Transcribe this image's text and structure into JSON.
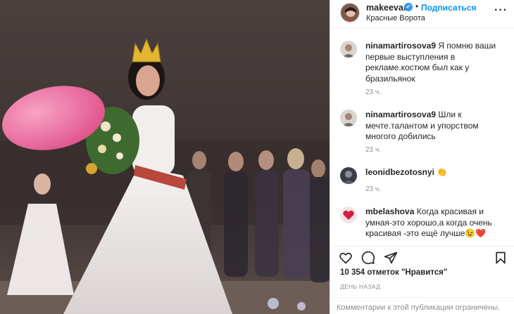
{
  "post": {
    "author": {
      "username": "makeevan",
      "verified_icon": "verified-badge-icon",
      "separator": "•",
      "follow_label": "Подписаться",
      "location": "Красные Ворота",
      "more_icon": "more-options-icon"
    },
    "comments": [
      {
        "username": "ninamartirosova9",
        "text": "Я помню ваши первые выступления в рекламе.костюм был как у бразильянок",
        "time": "23 ч."
      },
      {
        "username": "ninamartirosova9",
        "text": "Шли к мечте.талантом и упорством многого добились",
        "time": "23 ч."
      },
      {
        "username": "leonidbezotosnyi",
        "text": "👏",
        "time": "23 ч."
      },
      {
        "username": "mbelashova",
        "text": "Когда красивая и умная-это хорошо,а когда очень красивая -это ещё лучше😉❤️",
        "time": ""
      }
    ],
    "likes": "10 354 отметок \"Нравится\"",
    "date": "ДЕНЬ НАЗАД",
    "comments_limited": "Комментарии к этой публикации ограничены."
  },
  "colors": {
    "link": "#0095f6",
    "verified": "#3897f0",
    "muted": "#8e8e8e",
    "text": "#262626"
  }
}
